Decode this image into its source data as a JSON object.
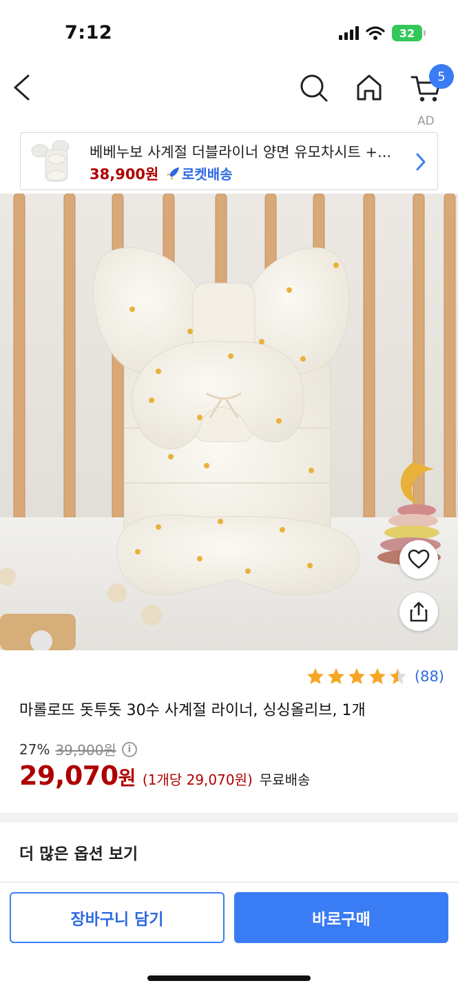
{
  "status_bar": {
    "time": "7:12",
    "battery": "32"
  },
  "nav": {
    "cart_count": "5"
  },
  "ad": {
    "label": "AD",
    "title": "베베누보 사계절 더블라이너 양면 유모차시트 +...",
    "price": "38,900원",
    "badge": "로켓배송"
  },
  "product": {
    "rating": 4.5,
    "review_count": "(88)",
    "title": "마롤로뜨 돗투돗 30수 사계절 라이너, 싱싱올리브, 1개",
    "discount_rate": "27%",
    "original_price": "39,900원",
    "price": "29,070",
    "price_currency": "원",
    "unit_price": "(1개당 29,070원)",
    "shipping": "무료배송"
  },
  "more_options": "더 많은 옵션 보기",
  "buttons": {
    "add_to_cart": "장바구니 담기",
    "buy_now": "바로구매"
  },
  "colors": {
    "accent": "#3a7cf4",
    "price": "#ae0000",
    "rocket": "#2d6ae0",
    "star": "#f5a623"
  }
}
